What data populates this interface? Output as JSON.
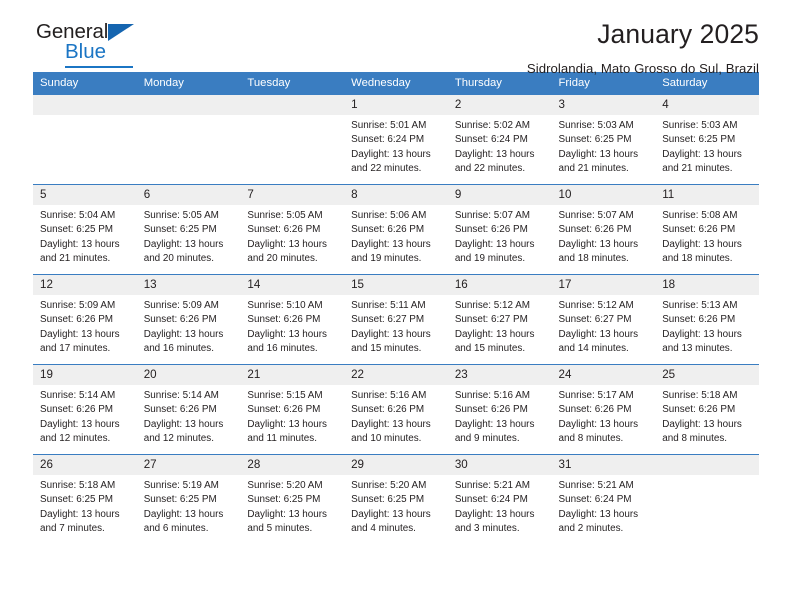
{
  "brand": {
    "name_dark": "General",
    "name_light": "Blue",
    "triangle_color": "#1565b0",
    "accent_color": "#1b75c4"
  },
  "header": {
    "month_title": "January 2025",
    "location": "Sidrolandia, Mato Grosso do Sul, Brazil"
  },
  "calendar": {
    "header_bg": "#3a7dc1",
    "daynum_bg": "#efefef",
    "weekdays": [
      "Sunday",
      "Monday",
      "Tuesday",
      "Wednesday",
      "Thursday",
      "Friday",
      "Saturday"
    ],
    "weeks": [
      [
        {
          "day": "",
          "empty": true
        },
        {
          "day": "",
          "empty": true
        },
        {
          "day": "",
          "empty": true
        },
        {
          "day": "1",
          "sunrise": "Sunrise: 5:01 AM",
          "sunset": "Sunset: 6:24 PM",
          "daylight_1": "Daylight: 13 hours",
          "daylight_2": "and 22 minutes."
        },
        {
          "day": "2",
          "sunrise": "Sunrise: 5:02 AM",
          "sunset": "Sunset: 6:24 PM",
          "daylight_1": "Daylight: 13 hours",
          "daylight_2": "and 22 minutes."
        },
        {
          "day": "3",
          "sunrise": "Sunrise: 5:03 AM",
          "sunset": "Sunset: 6:25 PM",
          "daylight_1": "Daylight: 13 hours",
          "daylight_2": "and 21 minutes."
        },
        {
          "day": "4",
          "sunrise": "Sunrise: 5:03 AM",
          "sunset": "Sunset: 6:25 PM",
          "daylight_1": "Daylight: 13 hours",
          "daylight_2": "and 21 minutes."
        }
      ],
      [
        {
          "day": "5",
          "sunrise": "Sunrise: 5:04 AM",
          "sunset": "Sunset: 6:25 PM",
          "daylight_1": "Daylight: 13 hours",
          "daylight_2": "and 21 minutes."
        },
        {
          "day": "6",
          "sunrise": "Sunrise: 5:05 AM",
          "sunset": "Sunset: 6:25 PM",
          "daylight_1": "Daylight: 13 hours",
          "daylight_2": "and 20 minutes."
        },
        {
          "day": "7",
          "sunrise": "Sunrise: 5:05 AM",
          "sunset": "Sunset: 6:26 PM",
          "daylight_1": "Daylight: 13 hours",
          "daylight_2": "and 20 minutes."
        },
        {
          "day": "8",
          "sunrise": "Sunrise: 5:06 AM",
          "sunset": "Sunset: 6:26 PM",
          "daylight_1": "Daylight: 13 hours",
          "daylight_2": "and 19 minutes."
        },
        {
          "day": "9",
          "sunrise": "Sunrise: 5:07 AM",
          "sunset": "Sunset: 6:26 PM",
          "daylight_1": "Daylight: 13 hours",
          "daylight_2": "and 19 minutes."
        },
        {
          "day": "10",
          "sunrise": "Sunrise: 5:07 AM",
          "sunset": "Sunset: 6:26 PM",
          "daylight_1": "Daylight: 13 hours",
          "daylight_2": "and 18 minutes."
        },
        {
          "day": "11",
          "sunrise": "Sunrise: 5:08 AM",
          "sunset": "Sunset: 6:26 PM",
          "daylight_1": "Daylight: 13 hours",
          "daylight_2": "and 18 minutes."
        }
      ],
      [
        {
          "day": "12",
          "sunrise": "Sunrise: 5:09 AM",
          "sunset": "Sunset: 6:26 PM",
          "daylight_1": "Daylight: 13 hours",
          "daylight_2": "and 17 minutes."
        },
        {
          "day": "13",
          "sunrise": "Sunrise: 5:09 AM",
          "sunset": "Sunset: 6:26 PM",
          "daylight_1": "Daylight: 13 hours",
          "daylight_2": "and 16 minutes."
        },
        {
          "day": "14",
          "sunrise": "Sunrise: 5:10 AM",
          "sunset": "Sunset: 6:26 PM",
          "daylight_1": "Daylight: 13 hours",
          "daylight_2": "and 16 minutes."
        },
        {
          "day": "15",
          "sunrise": "Sunrise: 5:11 AM",
          "sunset": "Sunset: 6:27 PM",
          "daylight_1": "Daylight: 13 hours",
          "daylight_2": "and 15 minutes."
        },
        {
          "day": "16",
          "sunrise": "Sunrise: 5:12 AM",
          "sunset": "Sunset: 6:27 PM",
          "daylight_1": "Daylight: 13 hours",
          "daylight_2": "and 15 minutes."
        },
        {
          "day": "17",
          "sunrise": "Sunrise: 5:12 AM",
          "sunset": "Sunset: 6:27 PM",
          "daylight_1": "Daylight: 13 hours",
          "daylight_2": "and 14 minutes."
        },
        {
          "day": "18",
          "sunrise": "Sunrise: 5:13 AM",
          "sunset": "Sunset: 6:26 PM",
          "daylight_1": "Daylight: 13 hours",
          "daylight_2": "and 13 minutes."
        }
      ],
      [
        {
          "day": "19",
          "sunrise": "Sunrise: 5:14 AM",
          "sunset": "Sunset: 6:26 PM",
          "daylight_1": "Daylight: 13 hours",
          "daylight_2": "and 12 minutes."
        },
        {
          "day": "20",
          "sunrise": "Sunrise: 5:14 AM",
          "sunset": "Sunset: 6:26 PM",
          "daylight_1": "Daylight: 13 hours",
          "daylight_2": "and 12 minutes."
        },
        {
          "day": "21",
          "sunrise": "Sunrise: 5:15 AM",
          "sunset": "Sunset: 6:26 PM",
          "daylight_1": "Daylight: 13 hours",
          "daylight_2": "and 11 minutes."
        },
        {
          "day": "22",
          "sunrise": "Sunrise: 5:16 AM",
          "sunset": "Sunset: 6:26 PM",
          "daylight_1": "Daylight: 13 hours",
          "daylight_2": "and 10 minutes."
        },
        {
          "day": "23",
          "sunrise": "Sunrise: 5:16 AM",
          "sunset": "Sunset: 6:26 PM",
          "daylight_1": "Daylight: 13 hours",
          "daylight_2": "and 9 minutes."
        },
        {
          "day": "24",
          "sunrise": "Sunrise: 5:17 AM",
          "sunset": "Sunset: 6:26 PM",
          "daylight_1": "Daylight: 13 hours",
          "daylight_2": "and 8 minutes."
        },
        {
          "day": "25",
          "sunrise": "Sunrise: 5:18 AM",
          "sunset": "Sunset: 6:26 PM",
          "daylight_1": "Daylight: 13 hours",
          "daylight_2": "and 8 minutes."
        }
      ],
      [
        {
          "day": "26",
          "sunrise": "Sunrise: 5:18 AM",
          "sunset": "Sunset: 6:25 PM",
          "daylight_1": "Daylight: 13 hours",
          "daylight_2": "and 7 minutes."
        },
        {
          "day": "27",
          "sunrise": "Sunrise: 5:19 AM",
          "sunset": "Sunset: 6:25 PM",
          "daylight_1": "Daylight: 13 hours",
          "daylight_2": "and 6 minutes."
        },
        {
          "day": "28",
          "sunrise": "Sunrise: 5:20 AM",
          "sunset": "Sunset: 6:25 PM",
          "daylight_1": "Daylight: 13 hours",
          "daylight_2": "and 5 minutes."
        },
        {
          "day": "29",
          "sunrise": "Sunrise: 5:20 AM",
          "sunset": "Sunset: 6:25 PM",
          "daylight_1": "Daylight: 13 hours",
          "daylight_2": "and 4 minutes."
        },
        {
          "day": "30",
          "sunrise": "Sunrise: 5:21 AM",
          "sunset": "Sunset: 6:24 PM",
          "daylight_1": "Daylight: 13 hours",
          "daylight_2": "and 3 minutes."
        },
        {
          "day": "31",
          "sunrise": "Sunrise: 5:21 AM",
          "sunset": "Sunset: 6:24 PM",
          "daylight_1": "Daylight: 13 hours",
          "daylight_2": "and 2 minutes."
        },
        {
          "day": "",
          "empty": true
        }
      ]
    ]
  }
}
